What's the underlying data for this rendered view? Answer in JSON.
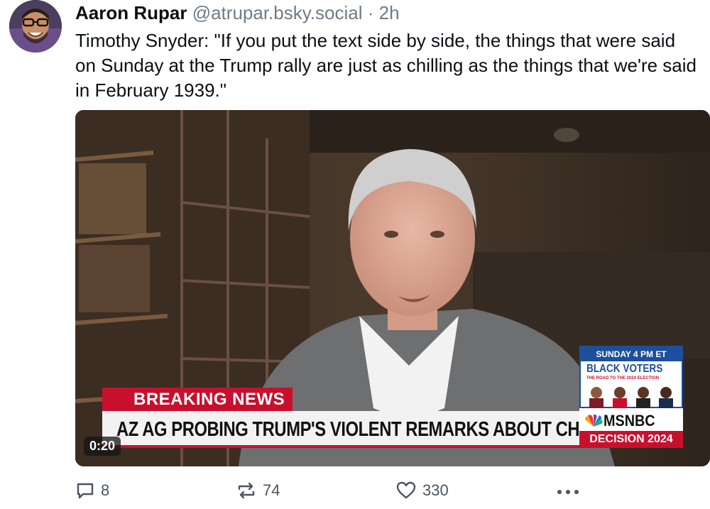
{
  "post": {
    "author_name": "Aaron Rupar",
    "handle": "@atrupar.bsky.social",
    "separator": "·",
    "time": "2h",
    "text": "Timothy Snyder: \"If you put the text side by side, the things that were said on Sunday at the Trump rally are just as chilling as the things that we're said in February 1939.\""
  },
  "video": {
    "duration": "0:20",
    "breaking_label": "BREAKING NEWS",
    "headline": "AZ AG PROBING TRUMP'S VIOLENT REMARKS ABOUT CHENEY",
    "promo_time": "SUNDAY 4 PM ET",
    "promo_title": "BLACK VOTERS",
    "promo_subtitle": "THE ROAD TO THE 2024 ELECTION",
    "network": "MSNBC",
    "decision": "DECISION 2024"
  },
  "actions": {
    "replies": "8",
    "reposts": "74",
    "likes": "330"
  },
  "icons": [
    "avatar",
    "reply-icon",
    "repost-icon",
    "like-icon",
    "more-icon"
  ],
  "colors": {
    "accent_red": "#c8102e",
    "msnbc_blue": "#1c4f9c",
    "muted_text": "#6f7b87"
  }
}
